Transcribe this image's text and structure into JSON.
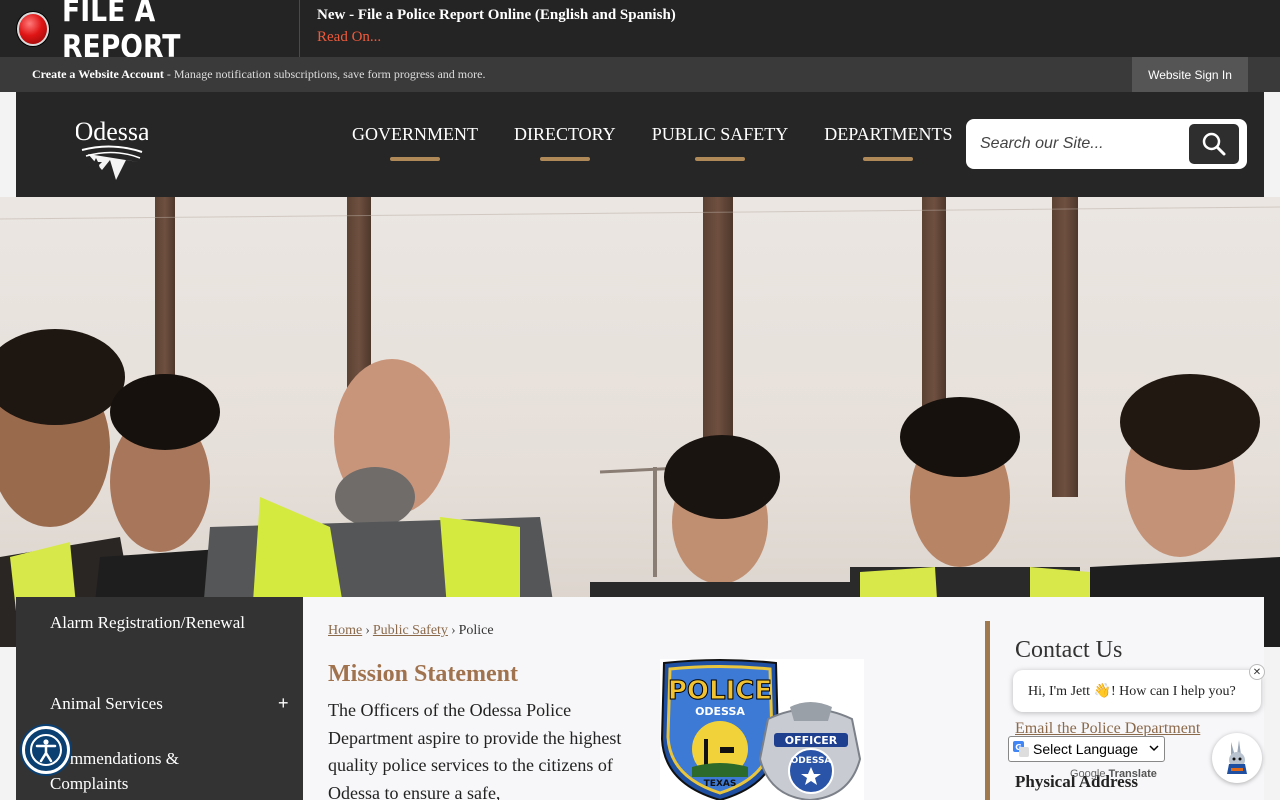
{
  "alert": {
    "button_label": "FILE A REPORT",
    "title": "New - File a Police Report Online (English and Spanish)",
    "link": "Read On..."
  },
  "account": {
    "create_label": "Create a Website Account",
    "description": " - Manage notification subscriptions, save form progress and more.",
    "signin_label": "Website Sign In"
  },
  "header": {
    "logo_text": "Odessa",
    "nav": [
      "GOVERNMENT",
      "DIRECTORY",
      "PUBLIC SAFETY",
      "DEPARTMENTS"
    ],
    "search_placeholder": "Search our Site..."
  },
  "sidebar": {
    "items": [
      "Alarm Registration/Renewal",
      "Animal Services",
      "Commendations & Complaints"
    ],
    "expand_symbol": "+"
  },
  "breadcrumb": {
    "home": "Home",
    "section": "Public Safety",
    "current": "Police",
    "separator": "›"
  },
  "mission": {
    "title": "Mission Statement",
    "body": "The Officers of the Odessa Police Department aspire to provide the highest quality police services to the citizens of Odessa to ensure a safe,"
  },
  "badges": {
    "police_top": "POLICE",
    "police_city": "ODESSA",
    "police_state": "TEXAS",
    "officer_top": "OFFICER",
    "officer_city": "ODESSA"
  },
  "contact": {
    "title": "Contact Us",
    "email_link": "Email the Police Department",
    "physical_address_label": "Physical Address"
  },
  "chat": {
    "greeting": "Hi, I'm Jett 👋! How can I help you?",
    "close_symbol": "✕"
  },
  "translate": {
    "select_label": "Select Language",
    "powered_prefix": "Google",
    "powered_word": "Translate"
  },
  "colors": {
    "accent_gold": "#b08958",
    "link_brown": "#8b6a4c",
    "alert_red": "#f05a3c",
    "header_dark": "#262626"
  },
  "icons": {
    "alert": "red-alert-button-icon",
    "search": "search-icon",
    "accessibility": "accessibility-icon",
    "chat_avatar": "jackrabbit-mascot-icon",
    "translate": "google-g-icon"
  }
}
